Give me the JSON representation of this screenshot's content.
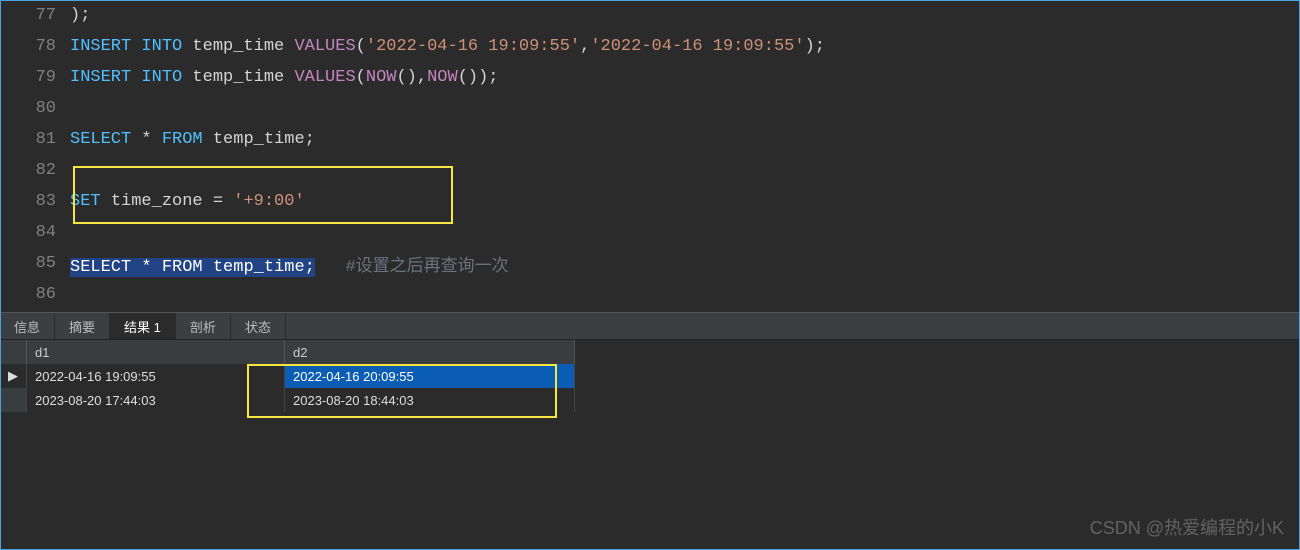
{
  "editor": {
    "lines": [
      {
        "num": "77",
        "tokens": [
          {
            "t": ");",
            "c": "punc"
          }
        ]
      },
      {
        "num": "78",
        "tokens": [
          {
            "t": "INSERT INTO",
            "c": "kw"
          },
          {
            "t": " ",
            "c": "id"
          },
          {
            "t": "temp_time",
            "c": "id"
          },
          {
            "t": " ",
            "c": "id"
          },
          {
            "t": "VALUES",
            "c": "fn"
          },
          {
            "t": "(",
            "c": "punc"
          },
          {
            "t": "'2022-04-16 19:09:55'",
            "c": "str"
          },
          {
            "t": ",",
            "c": "punc"
          },
          {
            "t": "'2022-04-16 19:09:55'",
            "c": "str"
          },
          {
            "t": ");",
            "c": "punc"
          }
        ]
      },
      {
        "num": "79",
        "tokens": [
          {
            "t": "INSERT INTO",
            "c": "kw"
          },
          {
            "t": " ",
            "c": "id"
          },
          {
            "t": "temp_time",
            "c": "id"
          },
          {
            "t": " ",
            "c": "id"
          },
          {
            "t": "VALUES",
            "c": "fn"
          },
          {
            "t": "(",
            "c": "punc"
          },
          {
            "t": "NOW",
            "c": "fn"
          },
          {
            "t": "()",
            "c": "punc"
          },
          {
            "t": ",",
            "c": "punc"
          },
          {
            "t": "NOW",
            "c": "fn"
          },
          {
            "t": "()",
            "c": "punc"
          },
          {
            "t": ");",
            "c": "punc"
          }
        ]
      },
      {
        "num": "80",
        "tokens": []
      },
      {
        "num": "81",
        "tokens": [
          {
            "t": "SELECT",
            "c": "kw"
          },
          {
            "t": " ",
            "c": "id"
          },
          {
            "t": "*",
            "c": "op"
          },
          {
            "t": " ",
            "c": "id"
          },
          {
            "t": "FROM",
            "c": "kw"
          },
          {
            "t": " ",
            "c": "id"
          },
          {
            "t": "temp_time",
            "c": "id"
          },
          {
            "t": ";",
            "c": "punc"
          }
        ]
      },
      {
        "num": "82",
        "tokens": []
      },
      {
        "num": "83",
        "tokens": [
          {
            "t": "SET",
            "c": "kw"
          },
          {
            "t": " ",
            "c": "id"
          },
          {
            "t": "time_zone",
            "c": "id"
          },
          {
            "t": " ",
            "c": "id"
          },
          {
            "t": "=",
            "c": "op"
          },
          {
            "t": " ",
            "c": "id"
          },
          {
            "t": "'+9:00'",
            "c": "str"
          }
        ]
      },
      {
        "num": "84",
        "tokens": []
      },
      {
        "num": "85",
        "tokens": [
          {
            "t": "SELECT",
            "c": "kw",
            "sel": true
          },
          {
            "t": " ",
            "c": "id",
            "sel": true
          },
          {
            "t": "*",
            "c": "op",
            "sel": true
          },
          {
            "t": " ",
            "c": "id",
            "sel": true
          },
          {
            "t": "FROM",
            "c": "kw",
            "sel": true
          },
          {
            "t": " ",
            "c": "id",
            "sel": true
          },
          {
            "t": "temp_time",
            "c": "id",
            "sel": true
          },
          {
            "t": ";",
            "c": "punc",
            "sel": true
          },
          {
            "t": "   ",
            "c": "id"
          },
          {
            "t": "#设置之后再查询一次",
            "c": "cmt"
          }
        ]
      },
      {
        "num": "86",
        "tokens": []
      }
    ]
  },
  "tabs": {
    "items": [
      {
        "label": "信息",
        "active": false
      },
      {
        "label": "摘要",
        "active": false
      },
      {
        "label": "结果 1",
        "active": true
      },
      {
        "label": "剖析",
        "active": false
      },
      {
        "label": "状态",
        "active": false
      }
    ]
  },
  "results": {
    "columns": [
      "d1",
      "d2"
    ],
    "rows": [
      {
        "d1": "2022-04-16 19:09:55",
        "d2": "2022-04-16 20:09:55",
        "selected": true,
        "marker": "▶"
      },
      {
        "d1": "2023-08-20 17:44:03",
        "d2": "2023-08-20 18:44:03",
        "selected": false,
        "marker": ""
      }
    ]
  },
  "watermark": "CSDN @热爱编程的小K"
}
